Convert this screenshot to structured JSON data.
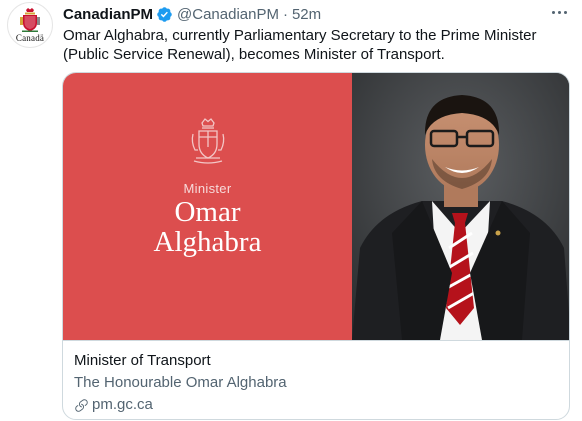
{
  "author": {
    "display_name": "CanadianPM",
    "handle": "@CanadianPM",
    "separator": "·",
    "time": "52m",
    "avatar_wordmark": "Canadä",
    "verified": true
  },
  "tweet": {
    "text": "Omar Alghabra, currently Parliamentary Secretary to the Prime Minister (Public Service Renewal), becomes Minister of Transport."
  },
  "card": {
    "image": {
      "label": "Minister",
      "name_line1": "Omar",
      "name_line2": "Alghabra",
      "panel_color": "#dc4e4e"
    },
    "title": "Minister of Transport",
    "description": "The Honourable Omar Alghabra",
    "domain": "pm.gc.ca"
  },
  "icons": {
    "more": "more-options-icon",
    "verified": "verified-badge-icon",
    "link": "link-icon"
  },
  "colors": {
    "accent": "#1d9bf0",
    "secondary_text": "#536471",
    "card_border": "#cfd9de"
  }
}
